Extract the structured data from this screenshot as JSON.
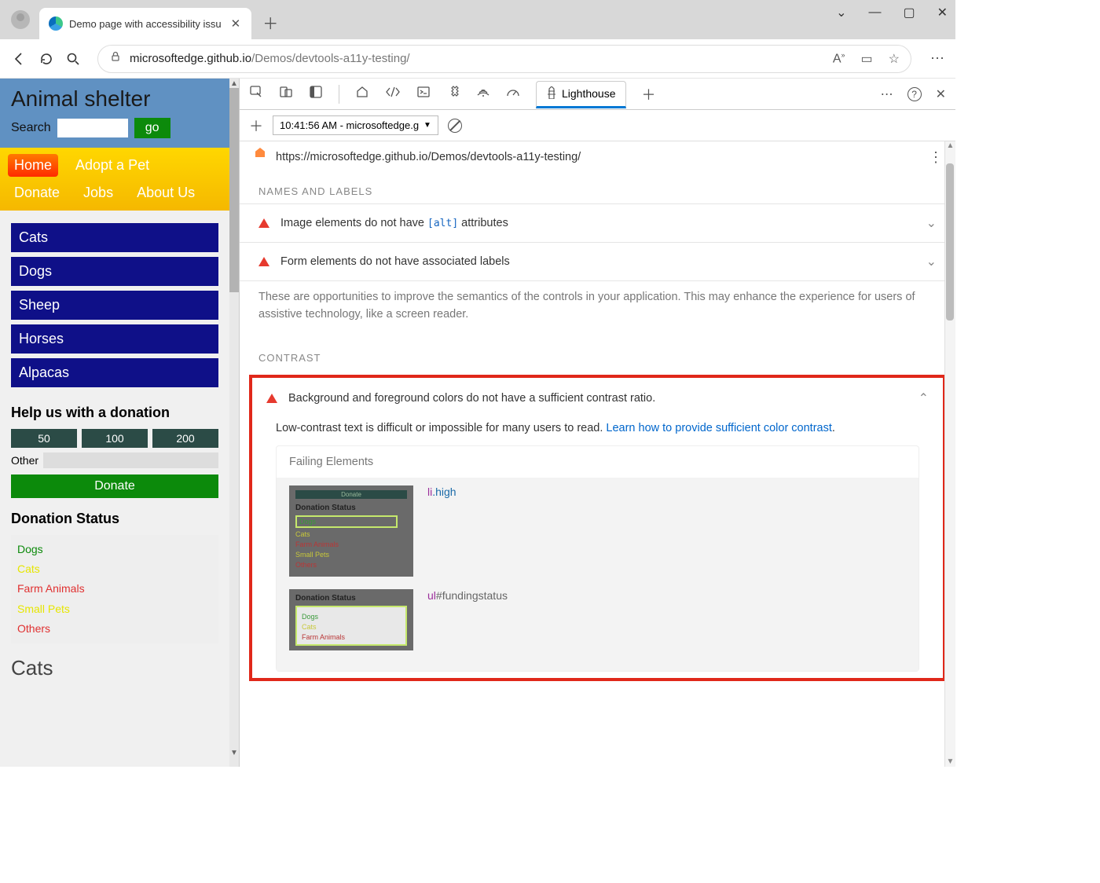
{
  "window": {
    "tab_title": "Demo page with accessibility issu"
  },
  "url_display": {
    "host": "microsoftedge.github.io",
    "path": "/Demos/devtools-a11y-testing/"
  },
  "page": {
    "title": "Animal shelter",
    "search_label": "Search",
    "go": "go",
    "nav": {
      "home": "Home",
      "adopt": "Adopt a Pet",
      "donate": "Donate",
      "jobs": "Jobs",
      "about": "About Us"
    },
    "categories": [
      "Cats",
      "Dogs",
      "Sheep",
      "Horses",
      "Alpacas"
    ],
    "donation": {
      "heading": "Help us with a donation",
      "amounts": [
        "50",
        "100",
        "200"
      ],
      "other": "Other",
      "button": "Donate"
    },
    "status": {
      "heading": "Donation Status",
      "items": [
        "Dogs",
        "Cats",
        "Farm Animals",
        "Small Pets",
        "Others"
      ]
    },
    "cats_header": "Cats"
  },
  "devtools": {
    "tab_lighthouse": "Lighthouse",
    "run_label": "10:41:56 AM - microsoftedge.g",
    "report_url": "https://microsoftedge.github.io/Demos/devtools-a11y-testing/",
    "sections": {
      "names": "NAMES AND LABELS",
      "contrast": "CONTRAST"
    },
    "audits": {
      "alt": {
        "pre": "Image elements do not have ",
        "code": "[alt]",
        "post": " attributes"
      },
      "labels": "Form elements do not have associated labels",
      "note": "These are opportunities to improve the semantics of the controls in your application. This may enhance the experience for users of assistive technology, like a screen reader.",
      "contrast_title": "Background and foreground colors do not have a sufficient contrast ratio.",
      "contrast_desc": "Low-contrast text is difficult or impossible for many users to read. ",
      "contrast_link": "Learn how to provide sufficient color contrast",
      "failing_title": "Failing Elements",
      "fail1_sel": {
        "tag": "li",
        "cls": ".high"
      },
      "fail2_sel": {
        "tag": "ul",
        "id": "#fundingstatus"
      },
      "thumb": {
        "donate": "Donate",
        "heading": "Donation Status",
        "dogs": "Dogs",
        "cats": "Cats",
        "farm": "Farm Animals",
        "small": "Small Pets",
        "others": "Others"
      }
    }
  }
}
